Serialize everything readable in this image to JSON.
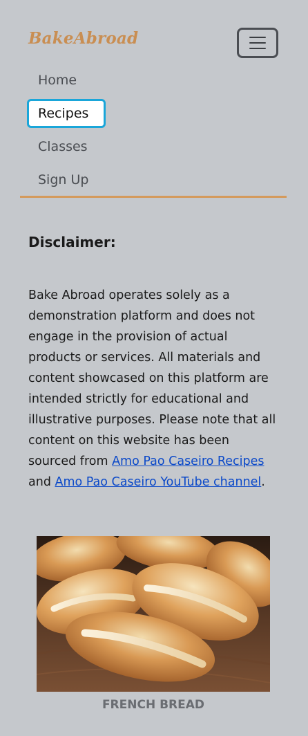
{
  "brand": {
    "name": "BakeAbroad"
  },
  "navbar": {
    "toggler_icon": "hamburger-menu-icon",
    "items": [
      {
        "label": "Home",
        "active": false
      },
      {
        "label": "Recipes",
        "active": true
      },
      {
        "label": "Classes",
        "active": false
      },
      {
        "label": "Sign Up",
        "active": false
      }
    ]
  },
  "colors": {
    "background": "#c5c8cc",
    "brand": "#c98e52",
    "accent_divider": "#d49a5c",
    "active_border": "#1aa6d9",
    "link": "#0b49c9"
  },
  "disclaimer": {
    "title": "Disclaimer:",
    "body_start": "Bake Abroad operates solely as a demonstration platform and does not engage in the provision of actual products or services. All materials and content showcased on this platform are intended strictly for educational and illustrative purposes. Please note that all content on this website has been sourced from ",
    "link1_text": "Amo Pao Caseiro Recipes",
    "between": " and ",
    "link2_text": "Amo Pao Caseiro YouTube channel",
    "end": "."
  },
  "featured": {
    "caption": "FRENCH BREAD"
  }
}
